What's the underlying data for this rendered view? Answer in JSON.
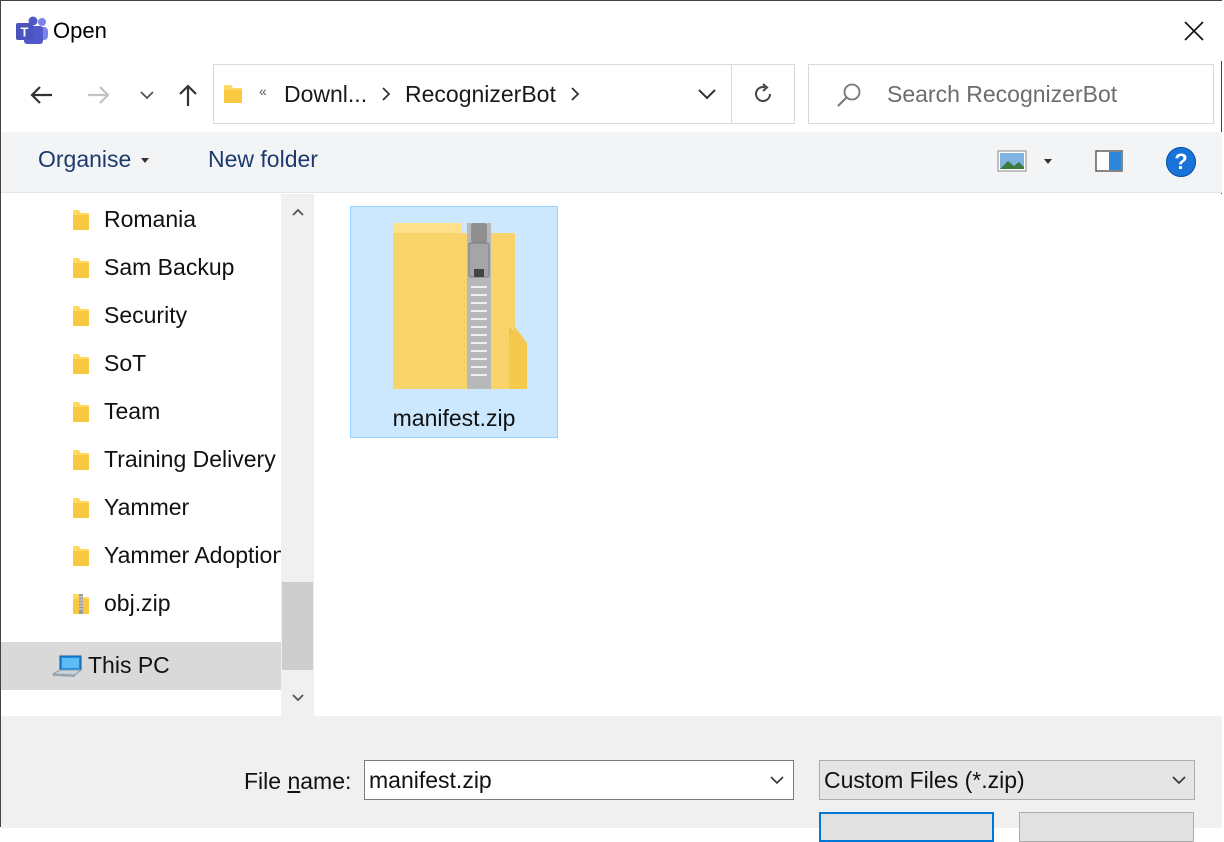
{
  "window": {
    "title": "Open",
    "close_glyph": "✕"
  },
  "navigation": {
    "back_icon": "back-arrow-icon",
    "forward_icon": "forward-arrow-icon",
    "recent_icon": "chevron-down-icon",
    "up_icon": "up-arrow-icon"
  },
  "address": {
    "overflow_glyph": "«",
    "crumbs": [
      "Downl...",
      "RecognizerBot"
    ],
    "refresh_glyph": "↻"
  },
  "search": {
    "placeholder": "Search RecognizerBot",
    "value": ""
  },
  "toolbar": {
    "organise_label": "Organise",
    "new_folder_label": "New folder",
    "help_glyph": "?"
  },
  "nav_pane": {
    "items": [
      {
        "label": "Romania",
        "icon": "folder-icon"
      },
      {
        "label": "Sam Backup",
        "icon": "folder-icon"
      },
      {
        "label": "Security",
        "icon": "folder-icon"
      },
      {
        "label": "SoT",
        "icon": "folder-icon"
      },
      {
        "label": "Team",
        "icon": "folder-icon"
      },
      {
        "label": "Training Delivery",
        "icon": "folder-icon"
      },
      {
        "label": "Yammer",
        "icon": "folder-icon"
      },
      {
        "label": "Yammer Adoption",
        "icon": "folder-icon"
      },
      {
        "label": "obj.zip",
        "icon": "zip-folder-icon"
      }
    ],
    "this_pc": {
      "label": "This PC",
      "icon": "computer-icon"
    }
  },
  "files": [
    {
      "name": "manifest.zip",
      "icon": "zip-folder-icon",
      "selected": true
    }
  ],
  "bottom": {
    "file_name_label_pre": "File ",
    "file_name_label_mnemonic": "n",
    "file_name_label_post": "ame:",
    "file_name_value": "manifest.zip",
    "file_type": "Custom Files (*.zip)"
  },
  "colors": {
    "selection_bg": "#cce8ff",
    "selection_border": "#99d1ff",
    "toolbar_text": "#1e3a6d",
    "accent": "#0078d7"
  }
}
